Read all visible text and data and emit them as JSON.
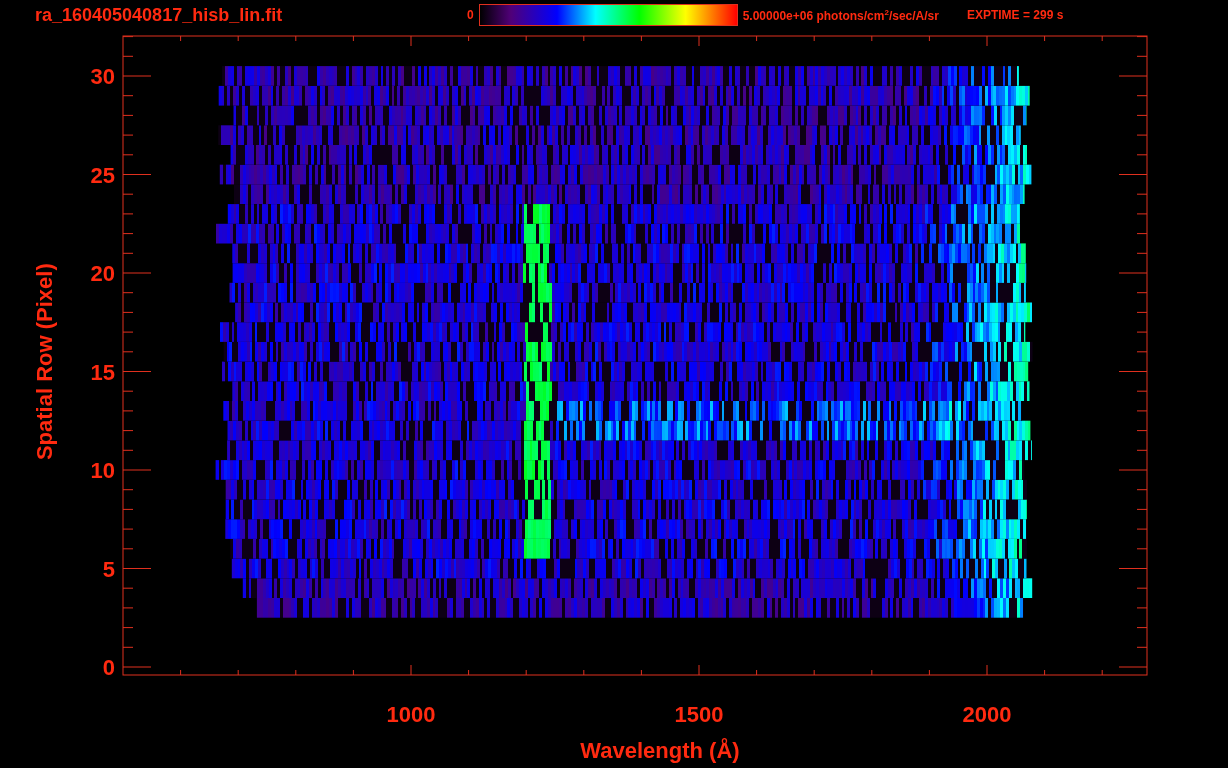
{
  "title": "ra_160405040817_hisb_lin.fit",
  "colorbar": {
    "min_label": "0",
    "max_label": "5.00000e+06 photons/cm$^{2}$/sec/A/sr"
  },
  "exposure": "EXPTIME = 299 s",
  "x_axis": {
    "label": "Wavelength (Å)",
    "tick_labels": [
      "1000",
      "1500",
      "2000"
    ]
  },
  "y_axis": {
    "label": "Spatial Row (Pixel)",
    "tick_labels": [
      "30",
      "25",
      "20",
      "15",
      "10",
      "5",
      "0"
    ]
  }
}
